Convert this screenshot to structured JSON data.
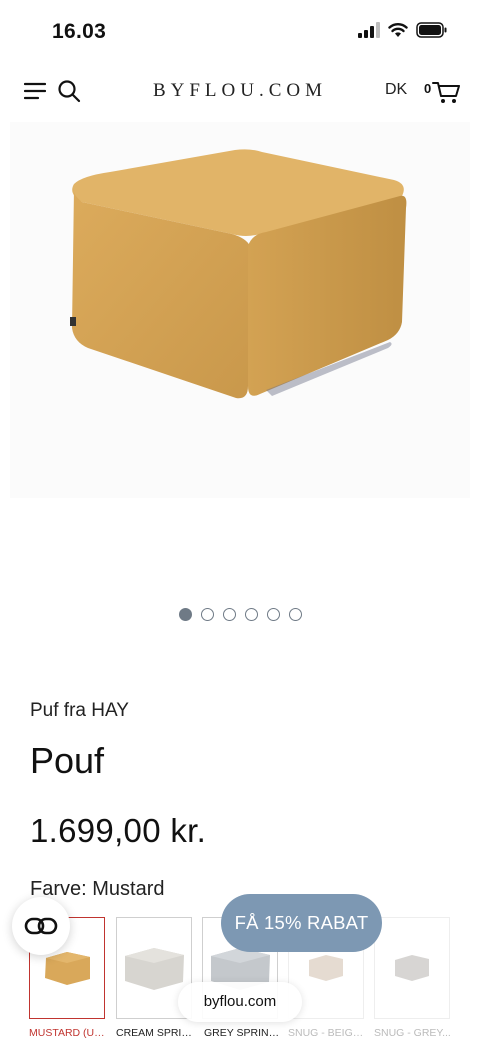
{
  "status_bar": {
    "time": "16.03"
  },
  "header": {
    "logo": "BYFLOU.COM",
    "country": "DK",
    "cart_count": "0"
  },
  "gallery": {
    "total": 6,
    "active_index": 0
  },
  "product": {
    "brand_line": "Puf fra HAY",
    "title": "Pouf",
    "price": "1.699,00 kr.",
    "color_label": "Farve: Mustard"
  },
  "variants": [
    {
      "label": "MUSTARD (UD...",
      "color": "#d9a85a",
      "selected": true
    },
    {
      "label": "CREAM SPRIN...",
      "color": "#d7d5d0",
      "selected": false
    },
    {
      "label": "GREY SPRINKLE",
      "color": "#c8ccd0",
      "selected": false
    },
    {
      "label": "SNUG - BEIGE...",
      "color": "#b69a7e",
      "selected": false
    },
    {
      "label": "SNUG - GREY...",
      "color": "#8f8a82",
      "selected": false
    }
  ],
  "discount_button": {
    "label": "FÅ 15% RABAT"
  },
  "browser": {
    "url": "byflou.com"
  },
  "colors": {
    "accent": "#7d98b3",
    "selected_border": "#c0342f",
    "product": "#dba85a"
  }
}
